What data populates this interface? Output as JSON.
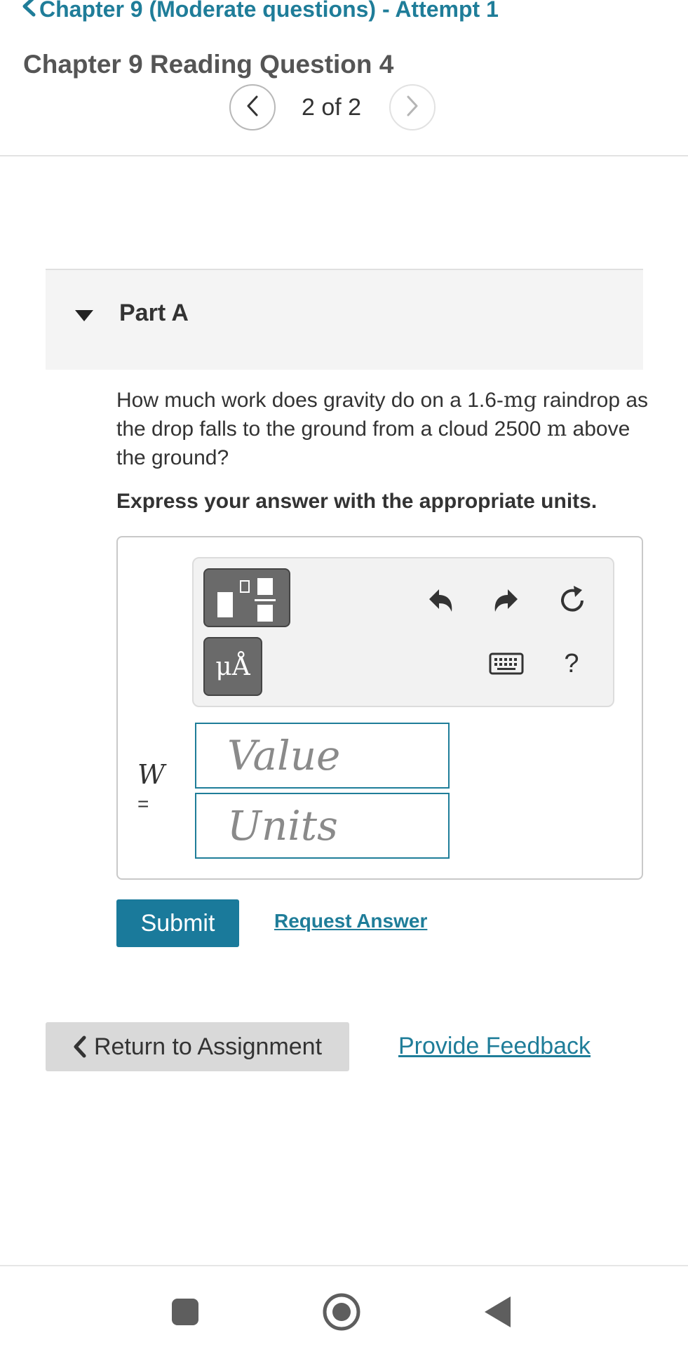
{
  "header": {
    "back_label": "Chapter 9 (Moderate questions) - Attempt 1",
    "title": "Chapter 9 Reading Question 4",
    "pager": {
      "current_label": "2 of 2"
    }
  },
  "part": {
    "label": "Part A"
  },
  "question": {
    "text_1": "How much work does gravity do on a 1.6-",
    "mass_unit": "mg",
    "text_2": " raindrop as the drop falls to the ground from a cloud 2500 ",
    "distance_unit": "m",
    "text_3": " above the ground?",
    "instruction": "Express your answer with the appropriate units."
  },
  "answer": {
    "variable": "W",
    "equals": "=",
    "value_placeholder": "Value",
    "units_placeholder": "Units",
    "symbol_button": "μÅ",
    "help_label": "?"
  },
  "actions": {
    "submit": "Submit",
    "request_answer": "Request Answer",
    "return": "Return to Assignment",
    "feedback": "Provide Feedback"
  },
  "colors": {
    "accent": "#1f7d99",
    "submit_bg": "#1a7a9b",
    "toolbar_button": "#6a6a6a"
  },
  "icons": {
    "back": "chevron-left-icon",
    "prev": "chevron-left-icon",
    "next": "chevron-right-icon",
    "collapse": "caret-down-icon",
    "templates": "fraction-template-icon",
    "undo": "undo-icon",
    "redo": "redo-icon",
    "reset": "reset-icon",
    "keyboard": "keyboard-icon",
    "nav_recents": "square-icon",
    "nav_home": "circle-icon",
    "nav_back": "triangle-back-icon"
  }
}
